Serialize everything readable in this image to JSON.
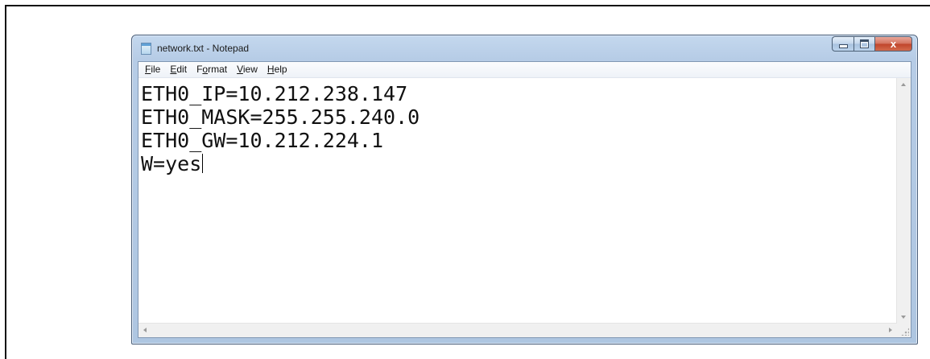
{
  "window": {
    "title": "network.txt - Notepad",
    "icon": "notepad-icon"
  },
  "caption_buttons": {
    "close_glyph": "x"
  },
  "menu": {
    "file": {
      "accel": "F",
      "rest": "ile"
    },
    "edit": {
      "accel": "E",
      "rest": "dit"
    },
    "format": {
      "pre": "F",
      "accel": "o",
      "rest": "rmat"
    },
    "view": {
      "accel": "V",
      "rest": "iew"
    },
    "help": {
      "accel": "H",
      "rest": "elp"
    }
  },
  "editor": {
    "lines": [
      "ETH0_IP=10.212.238.147",
      "ETH0_MASK=255.255.240.0",
      "ETH0_GW=10.212.224.1",
      "W=yes"
    ]
  },
  "colors": {
    "title_glass": "#b6cce6",
    "close_button": "#c1452b"
  }
}
